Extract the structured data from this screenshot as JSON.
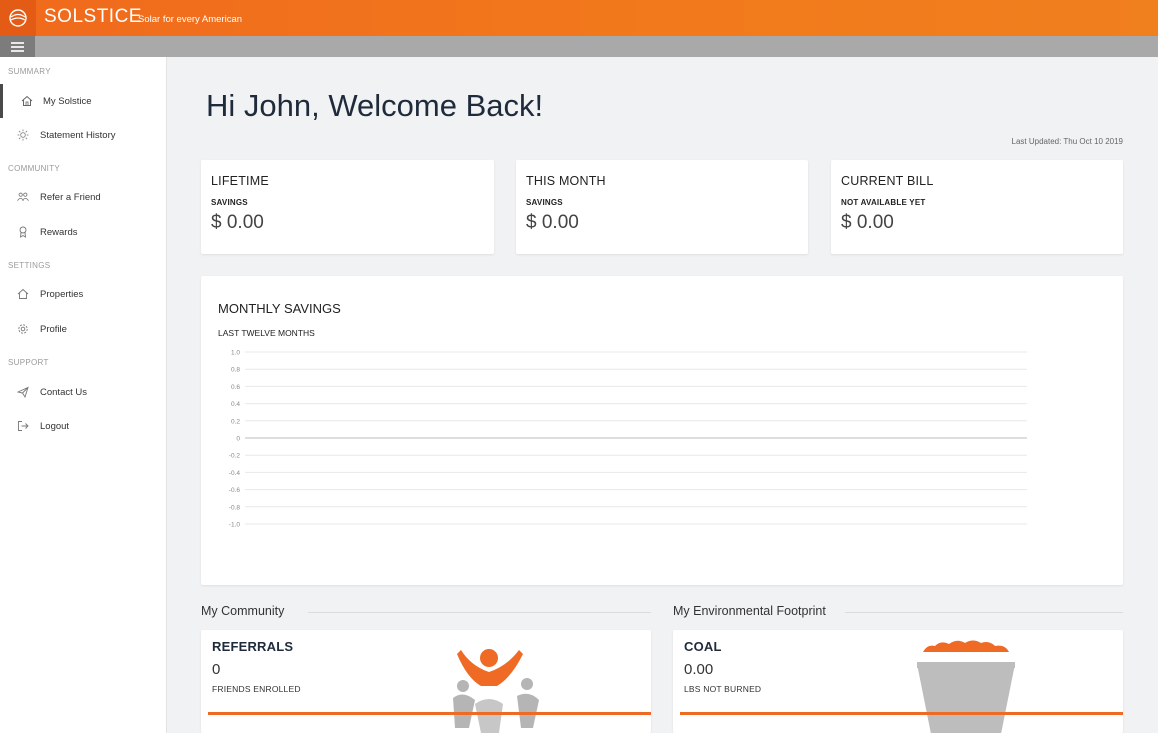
{
  "header": {
    "brand": "SOLSTICE",
    "tagline": "Solar for every American",
    "accent": "#f06a1c"
  },
  "sidebar": {
    "sections": [
      {
        "title": "SUMMARY",
        "items": [
          {
            "label": "My Solstice",
            "icon": "home-icon",
            "active": true
          },
          {
            "label": "Statement History",
            "icon": "sun-icon"
          }
        ]
      },
      {
        "title": "COMMUNITY",
        "items": [
          {
            "label": "Refer a Friend",
            "icon": "people-icon"
          },
          {
            "label": "Rewards",
            "icon": "award-icon"
          }
        ]
      },
      {
        "title": "SETTINGS",
        "items": [
          {
            "label": "Properties",
            "icon": "house-icon"
          },
          {
            "label": "Profile",
            "icon": "gear-icon"
          }
        ]
      },
      {
        "title": "SUPPORT",
        "items": [
          {
            "label": "Contact Us",
            "icon": "paper-plane-icon"
          },
          {
            "label": "Logout",
            "icon": "logout-icon"
          }
        ]
      }
    ]
  },
  "main": {
    "welcome": "Hi John, Welcome Back!",
    "last_updated": "Last Updated: Thu Oct 10 2019",
    "stats": [
      {
        "title": "LIFETIME",
        "sub": "SAVINGS",
        "value": "$ 0.00"
      },
      {
        "title": "THIS MONTH",
        "sub": "SAVINGS",
        "value": "$ 0.00"
      },
      {
        "title": "CURRENT BILL",
        "sub": "NOT AVAILABLE YET",
        "value": "$ 0.00"
      }
    ],
    "chart_title": "MONTHLY SAVINGS",
    "chart_subtitle": "LAST TWELVE MONTHS",
    "community_heading": "My Community",
    "environment_heading": "My Environmental Footprint",
    "referrals": {
      "title": "REFERRALS",
      "value": "0",
      "sub": "FRIENDS ENROLLED"
    },
    "coal": {
      "title": "COAL",
      "value": "0.00",
      "sub": "LBS NOT BURNED"
    }
  },
  "chart_data": {
    "type": "line",
    "title": "MONTHLY SAVINGS",
    "subtitle": "LAST TWELVE MONTHS",
    "y_ticks": [
      "1.0",
      "0.8",
      "0.6",
      "0.4",
      "0.2",
      "0",
      "-0.2",
      "-0.4",
      "-0.6",
      "-0.8",
      "-1.0"
    ],
    "ylim": [
      -1.0,
      1.0
    ],
    "series": [],
    "grid": true
  }
}
